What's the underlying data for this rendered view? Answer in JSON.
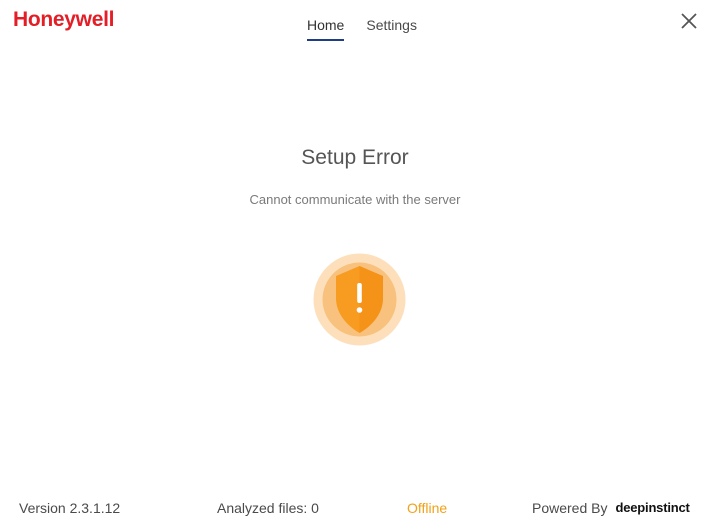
{
  "app": {
    "logo_text": "Honeywell",
    "brand_color": "#e41e26"
  },
  "nav": {
    "tabs": [
      {
        "label": "Home",
        "active": true
      },
      {
        "label": "Settings",
        "active": false
      }
    ],
    "active_underline_color": "#1f3c88"
  },
  "window": {
    "close_icon": "close-icon"
  },
  "status": {
    "title": "Setup Error",
    "message": "Cannot communicate with the server",
    "icon": "warning-shield-icon",
    "icon_colors": {
      "outer": "#fde0bb",
      "inner": "#f8c27e",
      "shield": "#f79b21"
    }
  },
  "footer": {
    "version": "Version 2.3.1.12",
    "analyzed_files": "Analyzed files: 0",
    "connection_status": "Offline",
    "connection_status_color": "#f0a21a",
    "powered_by": "Powered By",
    "powered_by_brand": "deepinstinct"
  }
}
